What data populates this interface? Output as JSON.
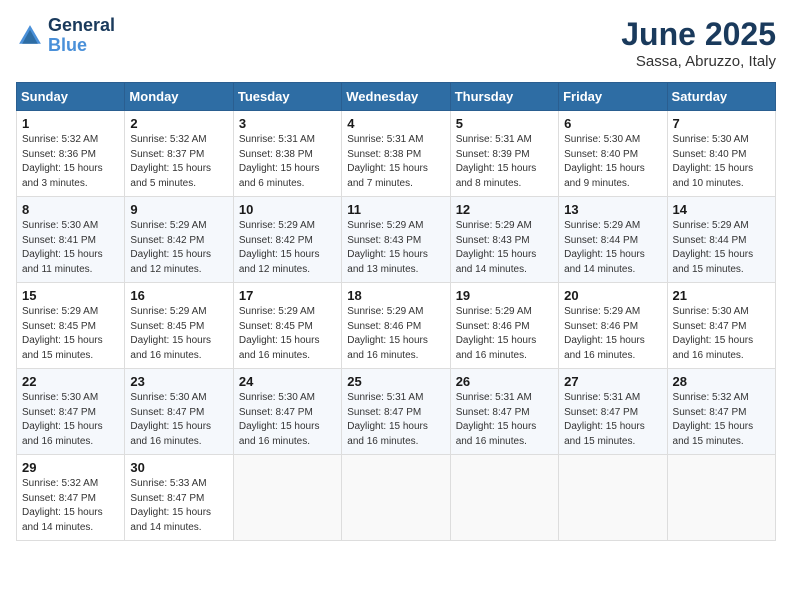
{
  "header": {
    "logo_line1": "General",
    "logo_line2": "Blue",
    "month": "June 2025",
    "location": "Sassa, Abruzzo, Italy"
  },
  "weekdays": [
    "Sunday",
    "Monday",
    "Tuesday",
    "Wednesday",
    "Thursday",
    "Friday",
    "Saturday"
  ],
  "weeks": [
    [
      {
        "day": "1",
        "lines": [
          "Sunrise: 5:32 AM",
          "Sunset: 8:36 PM",
          "Daylight: 15 hours",
          "and 3 minutes."
        ]
      },
      {
        "day": "2",
        "lines": [
          "Sunrise: 5:32 AM",
          "Sunset: 8:37 PM",
          "Daylight: 15 hours",
          "and 5 minutes."
        ]
      },
      {
        "day": "3",
        "lines": [
          "Sunrise: 5:31 AM",
          "Sunset: 8:38 PM",
          "Daylight: 15 hours",
          "and 6 minutes."
        ]
      },
      {
        "day": "4",
        "lines": [
          "Sunrise: 5:31 AM",
          "Sunset: 8:38 PM",
          "Daylight: 15 hours",
          "and 7 minutes."
        ]
      },
      {
        "day": "5",
        "lines": [
          "Sunrise: 5:31 AM",
          "Sunset: 8:39 PM",
          "Daylight: 15 hours",
          "and 8 minutes."
        ]
      },
      {
        "day": "6",
        "lines": [
          "Sunrise: 5:30 AM",
          "Sunset: 8:40 PM",
          "Daylight: 15 hours",
          "and 9 minutes."
        ]
      },
      {
        "day": "7",
        "lines": [
          "Sunrise: 5:30 AM",
          "Sunset: 8:40 PM",
          "Daylight: 15 hours",
          "and 10 minutes."
        ]
      }
    ],
    [
      {
        "day": "8",
        "lines": [
          "Sunrise: 5:30 AM",
          "Sunset: 8:41 PM",
          "Daylight: 15 hours",
          "and 11 minutes."
        ]
      },
      {
        "day": "9",
        "lines": [
          "Sunrise: 5:29 AM",
          "Sunset: 8:42 PM",
          "Daylight: 15 hours",
          "and 12 minutes."
        ]
      },
      {
        "day": "10",
        "lines": [
          "Sunrise: 5:29 AM",
          "Sunset: 8:42 PM",
          "Daylight: 15 hours",
          "and 12 minutes."
        ]
      },
      {
        "day": "11",
        "lines": [
          "Sunrise: 5:29 AM",
          "Sunset: 8:43 PM",
          "Daylight: 15 hours",
          "and 13 minutes."
        ]
      },
      {
        "day": "12",
        "lines": [
          "Sunrise: 5:29 AM",
          "Sunset: 8:43 PM",
          "Daylight: 15 hours",
          "and 14 minutes."
        ]
      },
      {
        "day": "13",
        "lines": [
          "Sunrise: 5:29 AM",
          "Sunset: 8:44 PM",
          "Daylight: 15 hours",
          "and 14 minutes."
        ]
      },
      {
        "day": "14",
        "lines": [
          "Sunrise: 5:29 AM",
          "Sunset: 8:44 PM",
          "Daylight: 15 hours",
          "and 15 minutes."
        ]
      }
    ],
    [
      {
        "day": "15",
        "lines": [
          "Sunrise: 5:29 AM",
          "Sunset: 8:45 PM",
          "Daylight: 15 hours",
          "and 15 minutes."
        ]
      },
      {
        "day": "16",
        "lines": [
          "Sunrise: 5:29 AM",
          "Sunset: 8:45 PM",
          "Daylight: 15 hours",
          "and 16 minutes."
        ]
      },
      {
        "day": "17",
        "lines": [
          "Sunrise: 5:29 AM",
          "Sunset: 8:45 PM",
          "Daylight: 15 hours",
          "and 16 minutes."
        ]
      },
      {
        "day": "18",
        "lines": [
          "Sunrise: 5:29 AM",
          "Sunset: 8:46 PM",
          "Daylight: 15 hours",
          "and 16 minutes."
        ]
      },
      {
        "day": "19",
        "lines": [
          "Sunrise: 5:29 AM",
          "Sunset: 8:46 PM",
          "Daylight: 15 hours",
          "and 16 minutes."
        ]
      },
      {
        "day": "20",
        "lines": [
          "Sunrise: 5:29 AM",
          "Sunset: 8:46 PM",
          "Daylight: 15 hours",
          "and 16 minutes."
        ]
      },
      {
        "day": "21",
        "lines": [
          "Sunrise: 5:30 AM",
          "Sunset: 8:47 PM",
          "Daylight: 15 hours",
          "and 16 minutes."
        ]
      }
    ],
    [
      {
        "day": "22",
        "lines": [
          "Sunrise: 5:30 AM",
          "Sunset: 8:47 PM",
          "Daylight: 15 hours",
          "and 16 minutes."
        ]
      },
      {
        "day": "23",
        "lines": [
          "Sunrise: 5:30 AM",
          "Sunset: 8:47 PM",
          "Daylight: 15 hours",
          "and 16 minutes."
        ]
      },
      {
        "day": "24",
        "lines": [
          "Sunrise: 5:30 AM",
          "Sunset: 8:47 PM",
          "Daylight: 15 hours",
          "and 16 minutes."
        ]
      },
      {
        "day": "25",
        "lines": [
          "Sunrise: 5:31 AM",
          "Sunset: 8:47 PM",
          "Daylight: 15 hours",
          "and 16 minutes."
        ]
      },
      {
        "day": "26",
        "lines": [
          "Sunrise: 5:31 AM",
          "Sunset: 8:47 PM",
          "Daylight: 15 hours",
          "and 16 minutes."
        ]
      },
      {
        "day": "27",
        "lines": [
          "Sunrise: 5:31 AM",
          "Sunset: 8:47 PM",
          "Daylight: 15 hours",
          "and 15 minutes."
        ]
      },
      {
        "day": "28",
        "lines": [
          "Sunrise: 5:32 AM",
          "Sunset: 8:47 PM",
          "Daylight: 15 hours",
          "and 15 minutes."
        ]
      }
    ],
    [
      {
        "day": "29",
        "lines": [
          "Sunrise: 5:32 AM",
          "Sunset: 8:47 PM",
          "Daylight: 15 hours",
          "and 14 minutes."
        ]
      },
      {
        "day": "30",
        "lines": [
          "Sunrise: 5:33 AM",
          "Sunset: 8:47 PM",
          "Daylight: 15 hours",
          "and 14 minutes."
        ]
      },
      {
        "day": "",
        "lines": []
      },
      {
        "day": "",
        "lines": []
      },
      {
        "day": "",
        "lines": []
      },
      {
        "day": "",
        "lines": []
      },
      {
        "day": "",
        "lines": []
      }
    ]
  ]
}
